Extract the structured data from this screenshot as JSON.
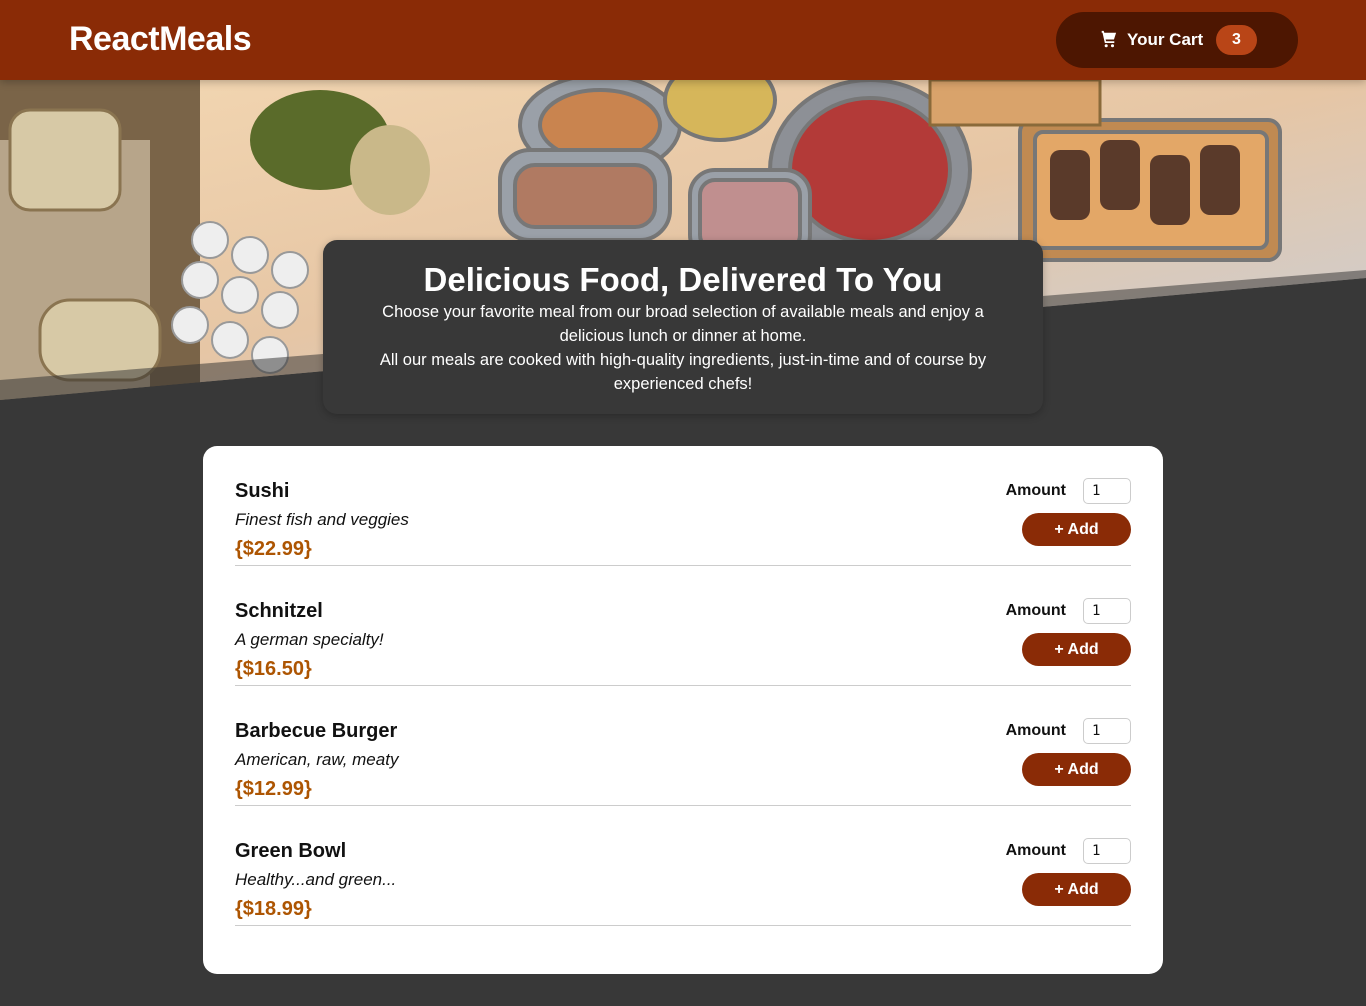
{
  "header": {
    "brand": "ReactMeals",
    "cart_label": "Your Cart",
    "cart_count": "3",
    "cart_icon": "shopping-cart-icon"
  },
  "summary": {
    "title": "Delicious Food, Delivered To You",
    "paragraph1": "Choose your favorite meal from our broad selection of available meals and enjoy a delicious lunch or dinner at home.",
    "paragraph2": "All our meals are cooked with high-quality ingredients, just-in-time and of course by experienced chefs!"
  },
  "meals": [
    {
      "name": "Sushi",
      "description": "Finest fish and veggies",
      "price": "{$22.99}",
      "amount_label": "Amount",
      "amount": "1",
      "add_label": "+ Add"
    },
    {
      "name": "Schnitzel",
      "description": "A german specialty!",
      "price": "{$16.50}",
      "amount_label": "Amount",
      "amount": "1",
      "add_label": "+ Add"
    },
    {
      "name": "Barbecue Burger",
      "description": "American, raw, meaty",
      "price": "{$12.99}",
      "amount_label": "Amount",
      "amount": "1",
      "add_label": "+ Add"
    },
    {
      "name": "Green Bowl",
      "description": "Healthy...and green...",
      "price": "{$18.99}",
      "amount_label": "Amount",
      "amount": "1",
      "add_label": "+ Add"
    }
  ],
  "colors": {
    "header": "#8a2b06",
    "cart_button": "#4d1601",
    "badge": "#b94517",
    "background": "#383838",
    "price": "#ad5502"
  }
}
